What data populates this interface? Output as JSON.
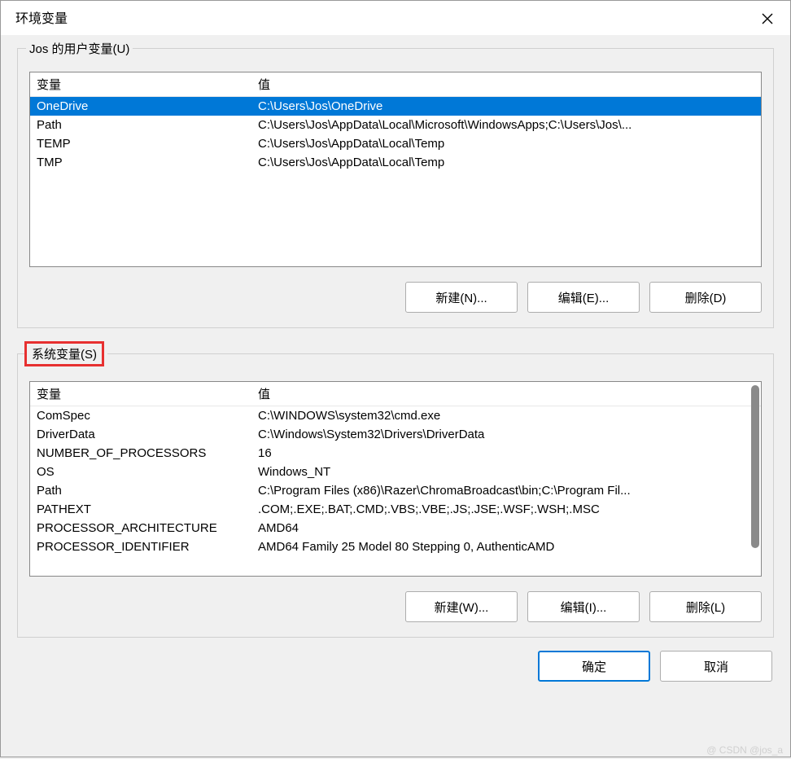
{
  "window": {
    "title": "环境变量"
  },
  "user_section": {
    "legend": "Jos 的用户变量(U)",
    "headers": {
      "variable": "变量",
      "value": "值"
    },
    "rows": [
      {
        "variable": "OneDrive",
        "value": "C:\\Users\\Jos\\OneDrive",
        "selected": true
      },
      {
        "variable": "Path",
        "value": "C:\\Users\\Jos\\AppData\\Local\\Microsoft\\WindowsApps;C:\\Users\\Jos\\..."
      },
      {
        "variable": "TEMP",
        "value": "C:\\Users\\Jos\\AppData\\Local\\Temp"
      },
      {
        "variable": "TMP",
        "value": "C:\\Users\\Jos\\AppData\\Local\\Temp"
      }
    ],
    "buttons": {
      "new": "新建(N)...",
      "edit": "编辑(E)...",
      "delete": "删除(D)"
    }
  },
  "system_section": {
    "legend": "系统变量(S)",
    "headers": {
      "variable": "变量",
      "value": "值"
    },
    "rows": [
      {
        "variable": "ComSpec",
        "value": "C:\\WINDOWS\\system32\\cmd.exe"
      },
      {
        "variable": "DriverData",
        "value": "C:\\Windows\\System32\\Drivers\\DriverData"
      },
      {
        "variable": "NUMBER_OF_PROCESSORS",
        "value": "16"
      },
      {
        "variable": "OS",
        "value": "Windows_NT"
      },
      {
        "variable": "Path",
        "value": "C:\\Program Files (x86)\\Razer\\ChromaBroadcast\\bin;C:\\Program Fil..."
      },
      {
        "variable": "PATHEXT",
        "value": ".COM;.EXE;.BAT;.CMD;.VBS;.VBE;.JS;.JSE;.WSF;.WSH;.MSC"
      },
      {
        "variable": "PROCESSOR_ARCHITECTURE",
        "value": "AMD64"
      },
      {
        "variable": "PROCESSOR_IDENTIFIER",
        "value": "AMD64 Family 25 Model 80 Stepping 0, AuthenticAMD"
      }
    ],
    "buttons": {
      "new": "新建(W)...",
      "edit": "编辑(I)...",
      "delete": "删除(L)"
    }
  },
  "footer": {
    "ok": "确定",
    "cancel": "取消"
  },
  "watermark": "@ CSDN @jos_a"
}
